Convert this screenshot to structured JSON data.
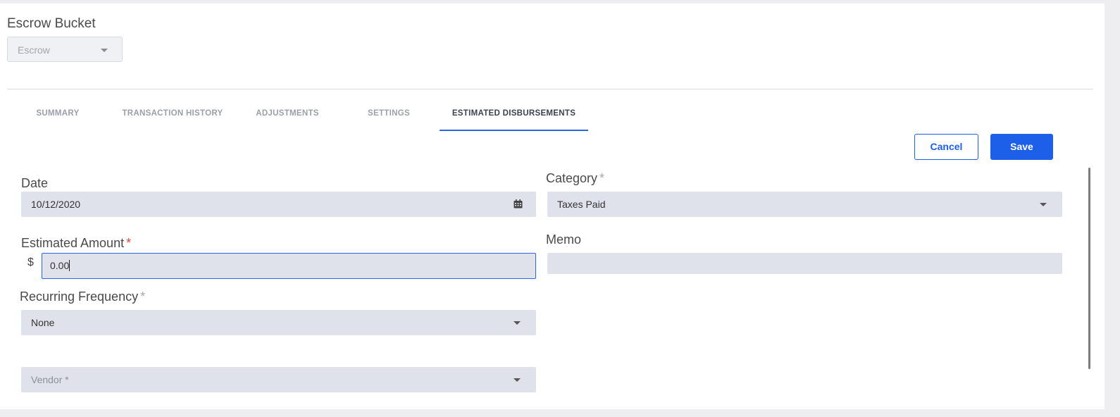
{
  "escrow_bucket": {
    "label": "Escrow Bucket",
    "selected": "Escrow"
  },
  "tabs": [
    {
      "label": "SUMMARY",
      "active": false
    },
    {
      "label": "TRANSACTION HISTORY",
      "active": false
    },
    {
      "label": "ADJUSTMENTS",
      "active": false
    },
    {
      "label": "SETTINGS",
      "active": false
    },
    {
      "label": "ESTIMATED DISBURSEMENTS",
      "active": true
    }
  ],
  "actions": {
    "cancel_label": "Cancel",
    "save_label": "Save"
  },
  "form": {
    "date": {
      "label": "Date",
      "value": "10/12/2020",
      "icon": "calendar-icon"
    },
    "category": {
      "label": "Category",
      "required_mark": "*",
      "value": "Taxes Paid"
    },
    "estimated_amount": {
      "label": "Estimated Amount",
      "required_mark": "*",
      "currency_symbol": "$",
      "value": "0.00"
    },
    "memo": {
      "label": "Memo",
      "value": ""
    },
    "recurring_frequency": {
      "label": "Recurring Frequency",
      "required_mark": "*",
      "value": "None"
    },
    "vendor": {
      "placeholder": "Vendor *",
      "value": ""
    }
  },
  "colors": {
    "accent": "#1d5fe8",
    "required": "#e0453a",
    "field_bg": "#dfe2ea"
  }
}
